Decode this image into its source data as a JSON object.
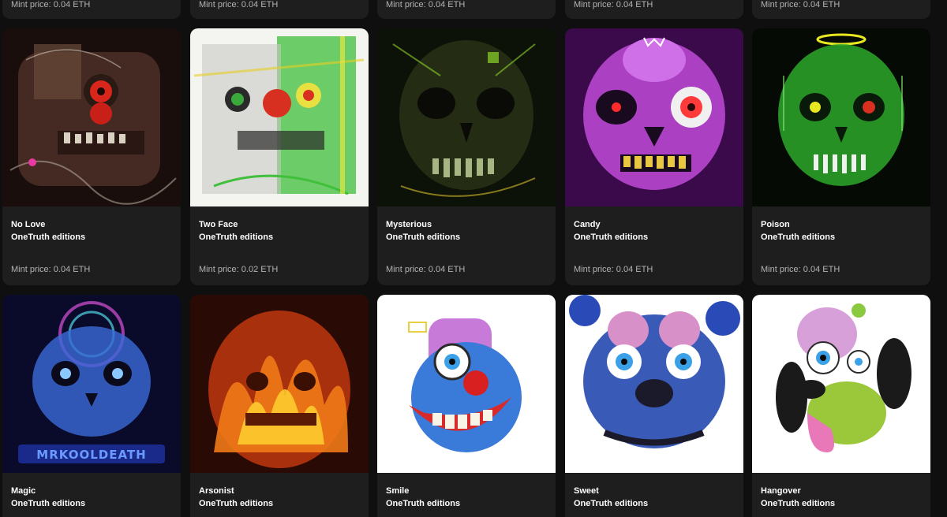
{
  "top_row": [
    {
      "price": "Mint price: 0.04 ETH"
    },
    {
      "price": "Mint price: 0.04 ETH"
    },
    {
      "price": "Mint price: 0.04 ETH"
    },
    {
      "price": "Mint price: 0.04 ETH"
    },
    {
      "price": "Mint price: 0.04 ETH"
    }
  ],
  "middle_row": [
    {
      "title": "No Love",
      "edition": "OneTruth editions",
      "price": "Mint price: 0.04 ETH",
      "art_colors": {
        "bg": "#1a0e0c",
        "face": "#5a3a30",
        "accent": "#d8261c"
      }
    },
    {
      "title": "Two Face",
      "edition": "OneTruth editions",
      "price": "Mint price: 0.02 ETH",
      "art_colors": {
        "bg": "#f4f4f0",
        "face": "#3fbf3a",
        "accent": "#d83020"
      }
    },
    {
      "title": "Mysterious",
      "edition": "OneTruth editions",
      "price": "Mint price: 0.04 ETH",
      "art_colors": {
        "bg": "#0d1208",
        "face": "#3a4a22",
        "accent": "#8fd428"
      }
    },
    {
      "title": "Candy",
      "edition": "OneTruth editions",
      "price": "Mint price: 0.04 ETH",
      "art_colors": {
        "bg": "#3a0a4a",
        "face": "#c04ad8",
        "accent": "#ff3a3a"
      }
    },
    {
      "title": "Poison",
      "edition": "OneTruth editions",
      "price": "Mint price: 0.04 ETH",
      "art_colors": {
        "bg": "#050a05",
        "face": "#2ea82a",
        "accent": "#e8e820"
      }
    }
  ],
  "bottom_row": [
    {
      "title": "Magic",
      "edition": "OneTruth editions",
      "art_colors": {
        "bg": "#0a0a2a",
        "face": "#3a6ad8",
        "accent": "#5a8aff"
      }
    },
    {
      "title": "Arsonist",
      "edition": "OneTruth editions",
      "art_colors": {
        "bg": "#2a0a04",
        "face": "#f07a18",
        "accent": "#ffd030"
      }
    },
    {
      "title": "Smile",
      "edition": "OneTruth editions",
      "art_colors": {
        "bg": "#ffffff",
        "face": "#3a7ad8",
        "accent": "#e02a2a"
      }
    },
    {
      "title": "Sweet",
      "edition": "OneTruth editions",
      "art_colors": {
        "bg": "#ffffff",
        "face": "#3a5ab8",
        "accent": "#d890c8"
      }
    },
    {
      "title": "Hangover",
      "edition": "OneTruth editions",
      "art_colors": {
        "bg": "#ffffff",
        "face": "#d8a0d8",
        "accent": "#9ac83a"
      }
    }
  ]
}
